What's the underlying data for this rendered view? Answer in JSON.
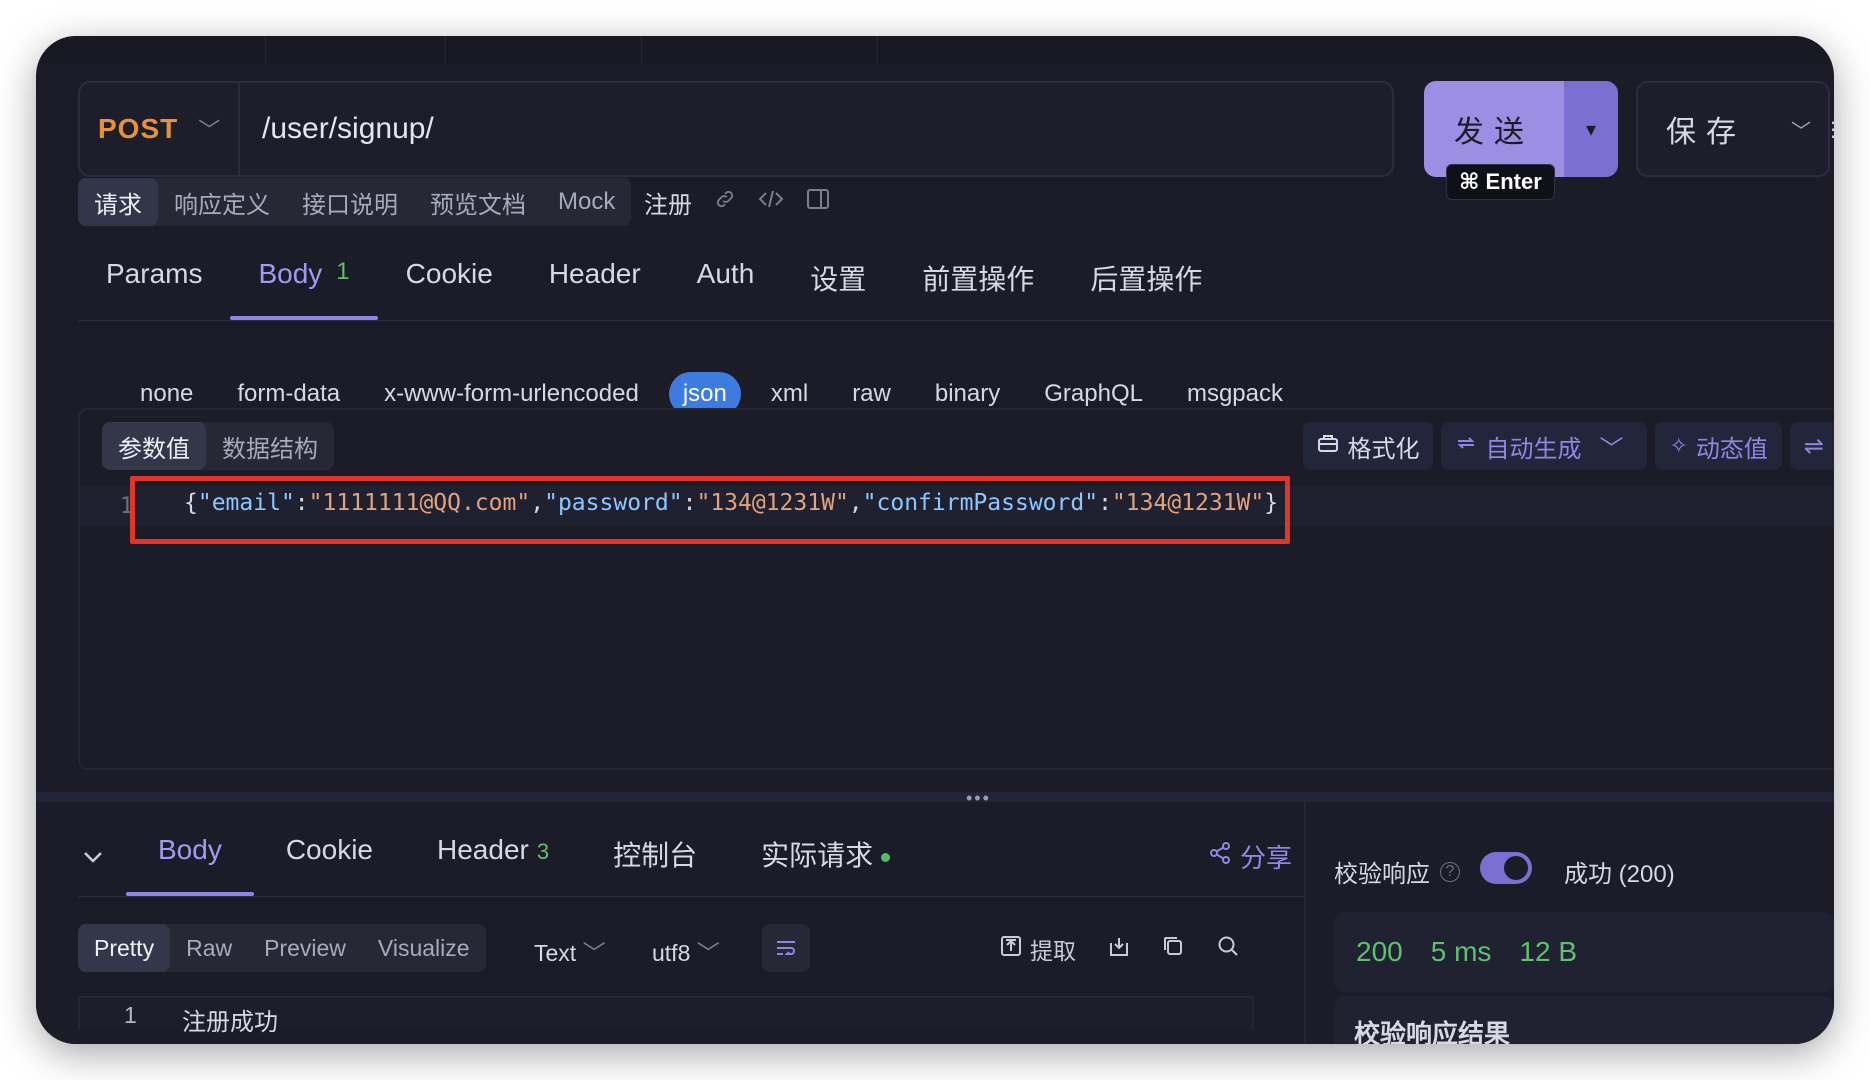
{
  "request": {
    "method": "POST",
    "url": "/user/signup/",
    "send_label": "发送",
    "save_label": "保存",
    "send_shortcut": "⌘ Enter"
  },
  "subnav": {
    "items": [
      "请求",
      "响应定义",
      "接口说明",
      "预览文档",
      "Mock"
    ],
    "active": "请求",
    "api_name": "注册"
  },
  "request_tabs": {
    "items": [
      {
        "label": "Params"
      },
      {
        "label": "Body",
        "badge": "1"
      },
      {
        "label": "Cookie"
      },
      {
        "label": "Header"
      },
      {
        "label": "Auth"
      },
      {
        "label": "设置"
      },
      {
        "label": "前置操作"
      },
      {
        "label": "后置操作"
      }
    ],
    "active": "Body"
  },
  "body_types": {
    "items": [
      "none",
      "form-data",
      "x-www-form-urlencoded",
      "json",
      "xml",
      "raw",
      "binary",
      "GraphQL",
      "msgpack"
    ],
    "active": "json"
  },
  "editor": {
    "tabs": [
      "参数值",
      "数据结构"
    ],
    "active_tab": "参数值",
    "tools": {
      "format": "格式化",
      "auto_generate": "自动生成",
      "dynamic_value": "动态值"
    },
    "line_number": "1",
    "json": {
      "email": "1111111@QQ.com",
      "password": "134@1231W",
      "confirmPassword": "134@1231W"
    }
  },
  "response": {
    "tabs": [
      {
        "label": "Body"
      },
      {
        "label": "Cookie"
      },
      {
        "label": "Header",
        "count": "3"
      },
      {
        "label": "控制台"
      },
      {
        "label": "实际请求",
        "dot": true
      }
    ],
    "active": "Body",
    "share_label": "分享",
    "view_modes": [
      "Pretty",
      "Raw",
      "Preview",
      "Visualize"
    ],
    "active_view": "Pretty",
    "format": "Text",
    "encoding": "utf8",
    "extract_label": "提取",
    "body_line_number": "1",
    "body_text": "注册成功"
  },
  "validation": {
    "label": "校验响应",
    "toggle_on": true,
    "status_text": "成功 (200)",
    "status_code": "200",
    "time": "5 ms",
    "size": "12 B",
    "result_title": "校验响应结果"
  },
  "colors": {
    "background": "#1b1c27",
    "accent": "#8f82e8",
    "method": "#e8913a",
    "success": "#5fc16b",
    "json_key": "#8cc8ff",
    "json_string": "#e5a17a",
    "highlight": "#e0352b"
  }
}
